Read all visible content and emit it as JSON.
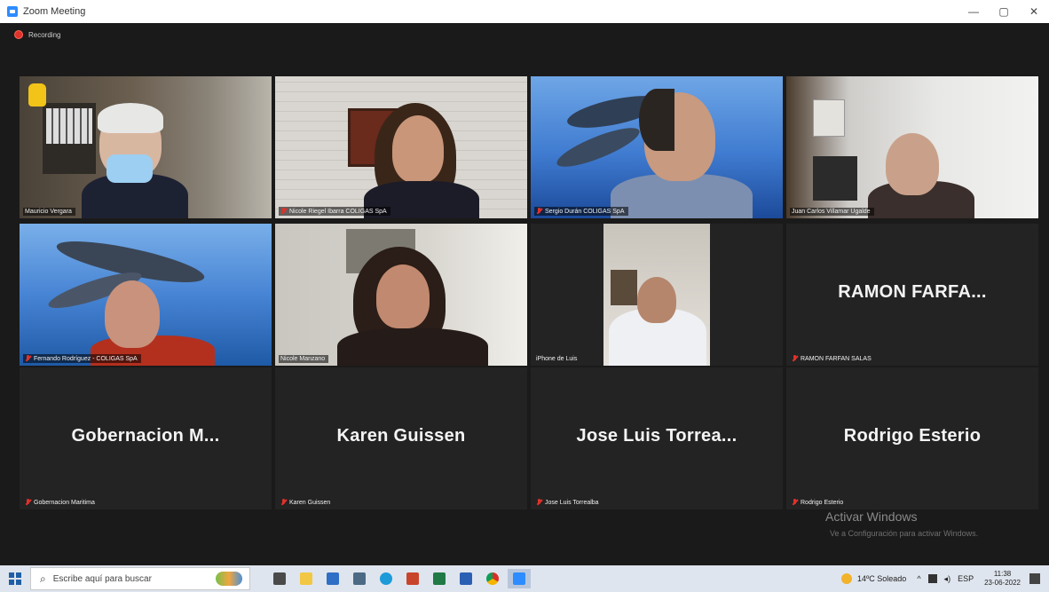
{
  "window": {
    "title": "Zoom Meeting",
    "controls": [
      "—",
      "▢",
      "✕"
    ]
  },
  "recording": {
    "label": "Recording"
  },
  "tiles": [
    {
      "name": "Mauricio Vergara",
      "muted": false,
      "active": true
    },
    {
      "name": "Nicole Riegel Ibarra COLIGAS SpA",
      "muted": true
    },
    {
      "name": "Sergio Durán COLIGAS SpA",
      "muted": true
    },
    {
      "name": "Juan Carlos Villamar Ugalde",
      "muted": false
    },
    {
      "name": "Fernando Rodríguez - COLIGAS SpA",
      "muted": true
    },
    {
      "name": "Nicole Manzano",
      "muted": false
    },
    {
      "name": "iPhone de Luis",
      "muted": false
    },
    {
      "display": "RAMON  FARFA...",
      "name": "RAMON FARFAN SALAS",
      "muted": true
    },
    {
      "display": "Gobernacion  M...",
      "name": "Gobernacion Maritima",
      "muted": true
    },
    {
      "display": "Karen Guissen",
      "name": "Karen Guissen",
      "muted": true
    },
    {
      "display": "Jose Luis Torrea...",
      "name": "Jose Luis Torrealba",
      "muted": true
    },
    {
      "display": "Rodrigo Esterio",
      "name": "Rodrigo Esterio",
      "muted": true
    }
  ],
  "watermark": {
    "title": "Activar Windows",
    "subtitle": "Ve a Configuración para activar Windows."
  },
  "taskbar": {
    "search_placeholder": "Escribe aquí para buscar",
    "weather": "14ºC Soleado",
    "lang": "ESP",
    "time": "11:38",
    "date": "23-06-2022"
  },
  "colors": {
    "active_border": "#a5d64a",
    "muted_red": "#e0312b",
    "tile_bg": "#232323"
  }
}
